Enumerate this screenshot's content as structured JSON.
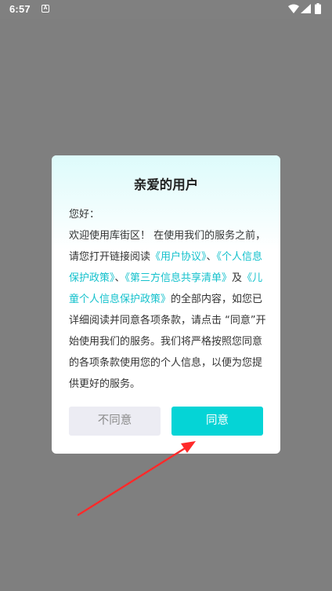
{
  "status_bar": {
    "time": "6:57",
    "app_icon_letter": "A"
  },
  "dialog": {
    "title": "亲爱的用户",
    "greeting": "您好：",
    "text_1": "欢迎使用库街区！ 在使用我们的服务之前，请您打开链接阅读",
    "link_user_agreement": "《用户协议》",
    "sep_1": "、",
    "link_privacy_policy": "《个人信息保护政策》",
    "sep_2": "、",
    "link_third_party": "《第三方信息共享清单》",
    "sep_3": "及",
    "link_children_policy": "《儿童个人信息保护政策》",
    "text_2": "的全部内容，如您已详细阅读并同意各项条款，请点击 “同意”开始使用我们的服务。我们将严格按照您同意的各项条款使用您的个人信息，以便为您提供更好的服务。",
    "disagree_label": "不同意",
    "agree_label": "同意"
  },
  "colors": {
    "overlay": "#7f7f7f",
    "accent": "#05d4d6",
    "link": "#14c1cc",
    "arrow": "#ff2a2a"
  }
}
